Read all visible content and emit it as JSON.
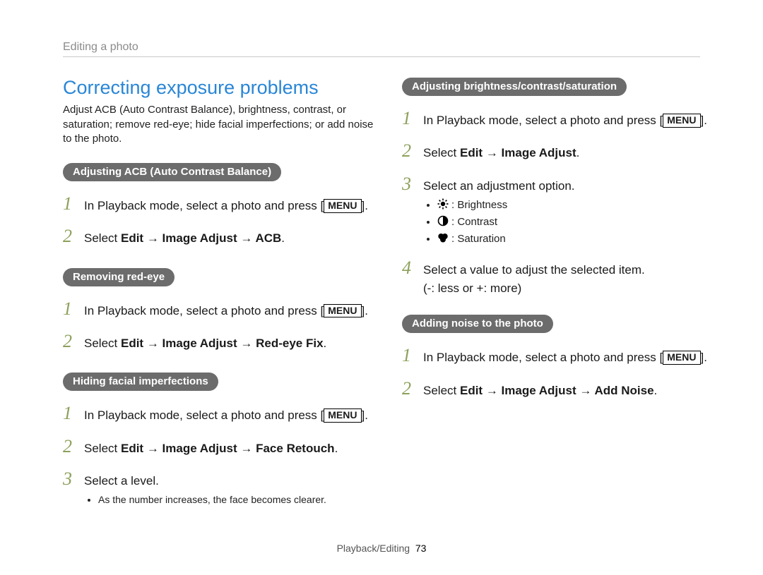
{
  "header": {
    "crumb": "Editing a photo"
  },
  "left": {
    "title": "Correcting exposure problems",
    "intro": "Adjust ACB (Auto Contrast Balance), brightness, contrast, or saturation; remove red-eye; hide facial imperfections; or add noise to the photo.",
    "acb": {
      "pill": "Adjusting ACB (Auto Contrast Balance)",
      "step1_pre": "In Playback mode, select a photo and press [",
      "step1_btn": "MENU",
      "step1_post": "].",
      "step2_pre": "Select ",
      "step2_bold": "Edit → Image Adjust → ACB",
      "step2_post": "."
    },
    "redeye": {
      "pill": "Removing red-eye",
      "step1_pre": "In Playback mode, select a photo and press [",
      "step1_btn": "MENU",
      "step1_post": "].",
      "step2_pre": "Select ",
      "step2_bold": "Edit → Image Adjust → Red-eye Fix",
      "step2_post": "."
    },
    "hide": {
      "pill": "Hiding facial imperfections",
      "step1_pre": "In Playback mode, select a photo and press [",
      "step1_btn": "MENU",
      "step1_post": "].",
      "step2_pre": "Select ",
      "step2_bold": "Edit → Image Adjust → Face Retouch",
      "step2_post": ".",
      "step3": "Select a level.",
      "note": "As the number increases, the face becomes clearer."
    }
  },
  "right": {
    "adj": {
      "pill": "Adjusting brightness/contrast/saturation",
      "step1_pre": "In Playback mode, select a photo and press [",
      "step1_btn": "MENU",
      "step1_post": "].",
      "step2_pre": "Select ",
      "step2_bold": "Edit → Image Adjust",
      "step2_post": ".",
      "step3": "Select an adjustment option.",
      "opt_brightness": ": Brightness",
      "opt_contrast": ": Contrast",
      "opt_saturation": ": Saturation",
      "step4_l1": "Select a value to adjust the selected item.",
      "step4_l2": "(-: less or +: more)"
    },
    "noise": {
      "pill": "Adding noise to the photo",
      "step1_pre": "In Playback mode, select a photo and press [",
      "step1_btn": "MENU",
      "step1_post": "].",
      "step2_pre": "Select ",
      "step2_bold": "Edit → Image Adjust → Add Noise",
      "step2_post": "."
    }
  },
  "footer": {
    "section": "Playback/Editing",
    "page": "73"
  }
}
